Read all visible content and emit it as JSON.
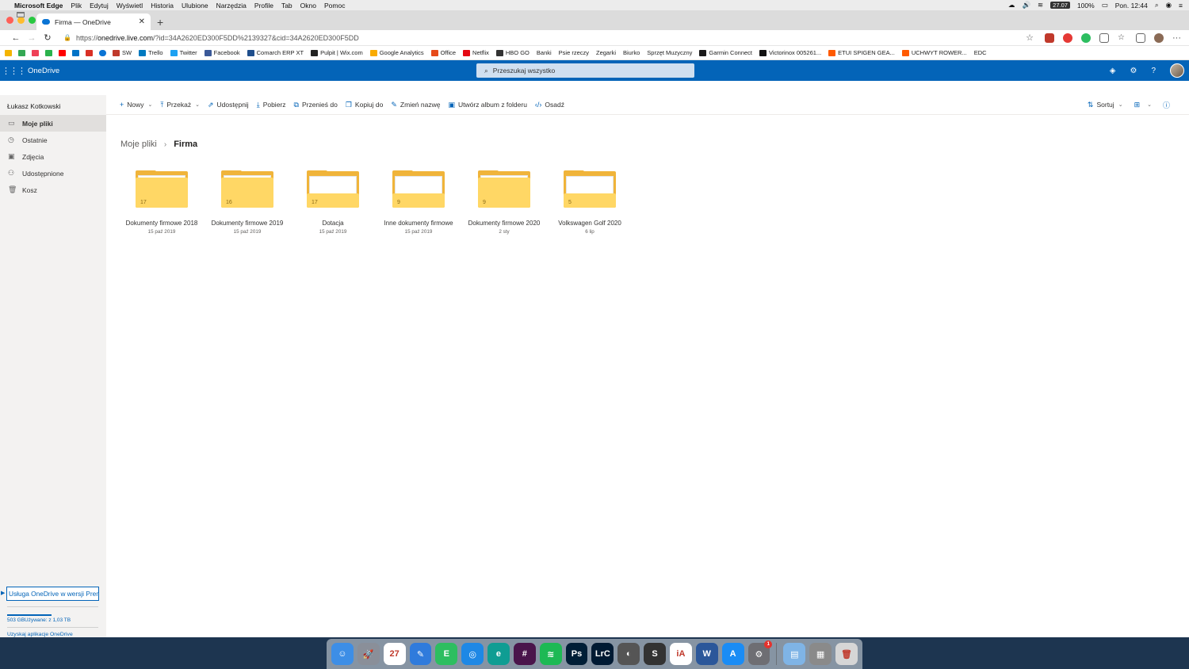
{
  "menubar": {
    "app_name": "Microsoft Edge",
    "items": [
      "Plik",
      "Edytuj",
      "Wyświetl",
      "Historia",
      "Ulubione",
      "Narzędzia",
      "Profile",
      "Tab",
      "Okno",
      "Pomoc"
    ],
    "badge": "27.07",
    "battery": "100%",
    "clock": "Pon. 12:44"
  },
  "browser": {
    "tab_title": "Firma — OneDrive",
    "url_prefix": "https://",
    "url_host": "onedrive.live.com",
    "url_rest": "/?id=34A2620ED300F5DD%2139327&cid=34A2620ED300F5DD",
    "bookmarks": [
      {
        "label": "SW",
        "color": "#c0392b"
      },
      {
        "label": "Trello",
        "color": "#0079bf"
      },
      {
        "label": "Twitter",
        "color": "#1da1f2"
      },
      {
        "label": "Facebook",
        "color": "#3b5998"
      },
      {
        "label": "Comarch ERP XT",
        "color": "#1f4e8c"
      },
      {
        "label": "Pulpit | Wix.com",
        "color": "#222222"
      },
      {
        "label": "Google Analytics",
        "color": "#f9ab00"
      },
      {
        "label": "Office",
        "color": "#e64a19"
      },
      {
        "label": "Netflix",
        "color": "#e50914"
      },
      {
        "label": "HBO GO",
        "color": "#333333"
      },
      {
        "label": "Banki",
        "color": "folder"
      },
      {
        "label": "Psie rzeczy",
        "color": "folder"
      },
      {
        "label": "Zegarki",
        "color": "folder"
      },
      {
        "label": "Biurko",
        "color": "folder"
      },
      {
        "label": "Sprzęt Muzyczny",
        "color": "folder"
      },
      {
        "label": "Garmin Connect",
        "color": "#1a1a1a"
      },
      {
        "label": "Victorinox 005261...",
        "color": "#111111"
      },
      {
        "label": "ETUI SPIGEN GEA...",
        "color": "#ff5a00"
      },
      {
        "label": "UCHWYT ROWER...",
        "color": "#ff5a00"
      },
      {
        "label": "EDC",
        "color": "folder"
      }
    ]
  },
  "onedrive": {
    "brand": "OneDrive",
    "search_placeholder": "Przeszukaj wszystko",
    "user_name": "Łukasz Kotkowski",
    "nav": [
      {
        "label": "Moje pliki",
        "icon": "folder-icon",
        "glyph": "▭",
        "active": true
      },
      {
        "label": "Ostatnie",
        "icon": "clock-icon",
        "glyph": "◷",
        "active": false
      },
      {
        "label": "Zdjęcia",
        "icon": "image-icon",
        "glyph": "▣",
        "active": false
      },
      {
        "label": "Udostępnione",
        "icon": "people-icon",
        "glyph": "⚇",
        "active": false
      },
      {
        "label": "Kosz",
        "icon": "trash-icon",
        "glyph": "🗑",
        "active": false
      }
    ],
    "premium_label": "Usługa OneDrive w wersji Premium",
    "storage_text": "503 GBUżywane: z 1,03 TB",
    "storage_fraction": 0.49,
    "get_apps": "Uzyskaj aplikacje OneDrive",
    "commands": {
      "new": "Nowy",
      "upload": "Przekaż",
      "share": "Udostępnij",
      "download": "Pobierz",
      "move": "Przenieś do",
      "copy": "Kopiuj do",
      "rename": "Zmień nazwę",
      "album": "Utwórz album z folderu",
      "embed": "Osadź",
      "sort": "Sortuj"
    },
    "breadcrumb": {
      "root": "Moje pliki",
      "current": "Firma"
    },
    "folders": [
      {
        "name": "Dokumenty firmowe 2018",
        "date": "15 paź 2019",
        "count": "17",
        "preview": false
      },
      {
        "name": "Dokumenty firmowe 2019",
        "date": "15 paź 2019",
        "count": "16",
        "preview": false
      },
      {
        "name": "Dotacja",
        "date": "15 paź 2019",
        "count": "17",
        "preview": true
      },
      {
        "name": "Inne dokumenty firmowe",
        "date": "15 paź 2019",
        "count": "9",
        "preview": true
      },
      {
        "name": "Dokumenty firmowe 2020",
        "date": "2 sty",
        "count": "9",
        "preview": false
      },
      {
        "name": "Volkswagen Golf 2020",
        "date": "6 lip",
        "count": "5",
        "preview": true
      }
    ]
  },
  "dock": [
    {
      "name": "finder",
      "color": "#3d8ee6",
      "glyph": "☺"
    },
    {
      "name": "launchpad",
      "color": "#8a8f99",
      "glyph": "🚀"
    },
    {
      "name": "calendar",
      "color": "#ffffff",
      "glyph": "27"
    },
    {
      "name": "things",
      "color": "#2f7bdc",
      "glyph": "✎"
    },
    {
      "name": "evernote",
      "color": "#2dbe60",
      "glyph": "E"
    },
    {
      "name": "safari",
      "color": "#1e88e5",
      "glyph": "◎"
    },
    {
      "name": "edge",
      "color": "#0f9d93",
      "glyph": "e"
    },
    {
      "name": "slack",
      "color": "#4a154b",
      "glyph": "#"
    },
    {
      "name": "spotify",
      "color": "#1db954",
      "glyph": "≋"
    },
    {
      "name": "photoshop",
      "color": "#001e36",
      "glyph": "Ps"
    },
    {
      "name": "lightroom",
      "color": "#001a33",
      "glyph": "LrC"
    },
    {
      "name": "screenflow",
      "color": "#555555",
      "glyph": "◐"
    },
    {
      "name": "scrivener",
      "color": "#333333",
      "glyph": "S"
    },
    {
      "name": "ia-writer",
      "color": "#ffffff",
      "glyph": "iA"
    },
    {
      "name": "word",
      "color": "#2b579a",
      "glyph": "W"
    },
    {
      "name": "app-store",
      "color": "#1a8cf5",
      "glyph": "A"
    },
    {
      "name": "system-preferences",
      "color": "#6e6e73",
      "glyph": "⚙",
      "badge": "1"
    },
    {
      "name": "sep"
    },
    {
      "name": "documents-folder",
      "color": "#7fb4e6",
      "glyph": "▤"
    },
    {
      "name": "photos-stack",
      "color": "#8a8a8a",
      "glyph": "▦"
    },
    {
      "name": "trash",
      "color": "#d6d6d6",
      "glyph": "🗑"
    }
  ],
  "colors": {
    "accent": "#0364b8",
    "folder_front": "#ffd765",
    "folder_back": "#f0b43a"
  }
}
